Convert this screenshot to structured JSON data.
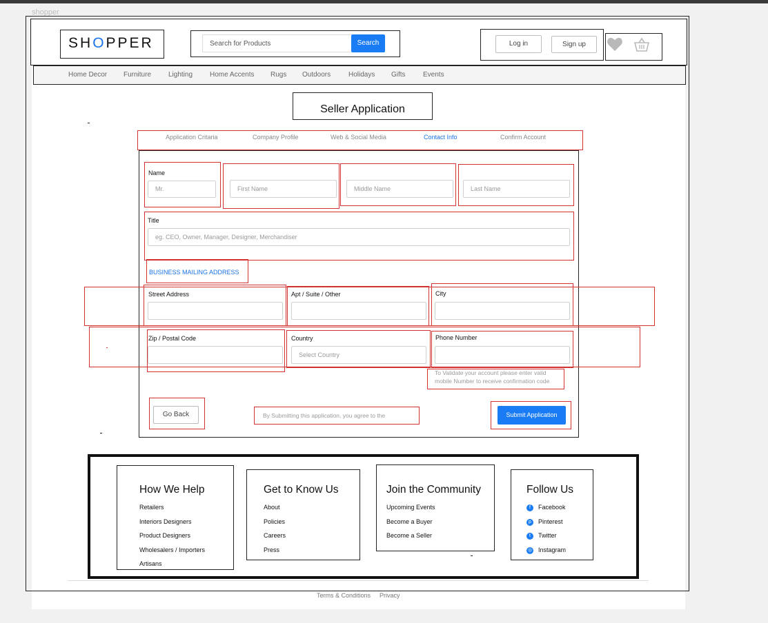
{
  "frame_label": "shopper",
  "header": {
    "logo": {
      "before": "SH",
      "highlight": "O",
      "after": "PPER"
    },
    "search_placeholder": "Search for Products",
    "search_button": "Search",
    "login": "Log in",
    "signup": "Sign up",
    "icons": [
      "heart-icon",
      "basket-icon"
    ]
  },
  "nav": [
    "Home Decor",
    "Furniture",
    "Lighting",
    "Home Accents",
    "Rugs",
    "Outdoors",
    "Holidays",
    "Gifts",
    "Events"
  ],
  "page_title": "Seller Application",
  "steps": {
    "items": [
      "Application Critaria",
      "Company Profile",
      "Web & Social Media",
      "Contact Info",
      "Confirm Account"
    ],
    "active": "Contact Info"
  },
  "form": {
    "name_label": "Name",
    "salutation_placeholder": "Mr.",
    "first_name_placeholder": "First Name",
    "middle_name_placeholder": "Middle Name",
    "last_name_placeholder": "Last Name",
    "title_label": "Title",
    "title_placeholder": "eg. CEO, Owner, Manager, Designer, Merchandiser",
    "address_section": "BUSINESS MAILING ADDRESS",
    "street_label": "Street Address",
    "apt_label": "Apt / Suite / Other",
    "city_label": "City",
    "zip_label": "Zip / Postal Code",
    "country_label": "Country",
    "country_placeholder": "Select Country",
    "phone_label": "Phone Number",
    "phone_help_1": "To Validate your account please enter valid",
    "phone_help_2": "mobile Number to receive confirmation code",
    "go_back": "Go Back",
    "agreement": "By Submitting this application, you agree to the",
    "submit": "Submit Application"
  },
  "footer": {
    "columns": [
      {
        "heading": "How We Help",
        "links": [
          "Retailers",
          "Interiors Designers",
          "Product Designers",
          "Wholesalers / Importers",
          "Artisans"
        ]
      },
      {
        "heading": "Get to Know Us",
        "links": [
          "About",
          "Policies",
          "Careers",
          "Press"
        ]
      },
      {
        "heading": "Join the Community",
        "links": [
          "Upcoming Events",
          "Become a Buyer",
          "Become a Seller"
        ]
      },
      {
        "heading": "Follow Us",
        "links": [
          "Facebook",
          "Pinterest",
          "Twitter",
          "Instagram"
        ]
      }
    ],
    "social_icons": [
      "facebook-icon",
      "pinterest-icon",
      "twitter-icon",
      "instagram-icon"
    ],
    "terms": "Terms & Conditions",
    "privacy": "Privacy"
  },
  "colors": {
    "accent": "#1a7cf5",
    "annotation": "#d32f2f"
  }
}
